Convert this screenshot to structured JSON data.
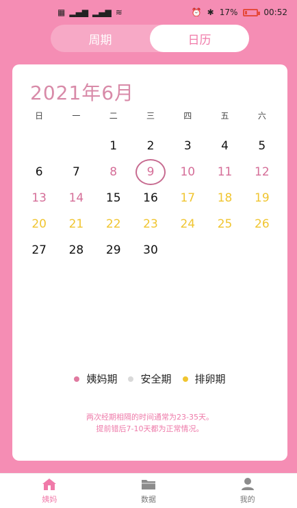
{
  "status_bar": {
    "left_icons": [
      "qr-icon",
      "signal-icon",
      "signal-icon",
      "wifi-icon"
    ],
    "right": {
      "battery": "17%",
      "time": "00:52"
    }
  },
  "segment": {
    "tabs": [
      {
        "label": "周期",
        "active": false
      },
      {
        "label": "日历",
        "active": true
      }
    ]
  },
  "calendar": {
    "title": "2021年6月",
    "weekdays": [
      "日",
      "一",
      "二",
      "三",
      "四",
      "五",
      "六"
    ],
    "days": [
      {
        "d": "",
        "type": "empty"
      },
      {
        "d": "",
        "type": "empty"
      },
      {
        "d": "1",
        "type": "normal"
      },
      {
        "d": "2",
        "type": "normal"
      },
      {
        "d": "3",
        "type": "normal"
      },
      {
        "d": "4",
        "type": "normal"
      },
      {
        "d": "5",
        "type": "normal"
      },
      {
        "d": "6",
        "type": "normal"
      },
      {
        "d": "7",
        "type": "normal"
      },
      {
        "d": "8",
        "type": "period"
      },
      {
        "d": "9",
        "type": "period",
        "today": true
      },
      {
        "d": "10",
        "type": "period"
      },
      {
        "d": "11",
        "type": "period"
      },
      {
        "d": "12",
        "type": "period"
      },
      {
        "d": "13",
        "type": "period"
      },
      {
        "d": "14",
        "type": "period"
      },
      {
        "d": "15",
        "type": "normal"
      },
      {
        "d": "16",
        "type": "normal"
      },
      {
        "d": "17",
        "type": "ovulation"
      },
      {
        "d": "18",
        "type": "ovulation"
      },
      {
        "d": "19",
        "type": "ovulation"
      },
      {
        "d": "20",
        "type": "ovulation"
      },
      {
        "d": "21",
        "type": "ovulation"
      },
      {
        "d": "22",
        "type": "ovulation"
      },
      {
        "d": "23",
        "type": "ovulation"
      },
      {
        "d": "24",
        "type": "ovulation"
      },
      {
        "d": "25",
        "type": "ovulation"
      },
      {
        "d": "26",
        "type": "ovulation"
      },
      {
        "d": "27",
        "type": "normal"
      },
      {
        "d": "28",
        "type": "normal"
      },
      {
        "d": "29",
        "type": "normal"
      },
      {
        "d": "30",
        "type": "normal"
      }
    ]
  },
  "legend": [
    {
      "label": "姨妈期",
      "color": "#e07aa0"
    },
    {
      "label": "安全期",
      "color": "#d9d9d9"
    },
    {
      "label": "排卵期",
      "color": "#f0c530"
    }
  ],
  "note": {
    "line1": "两次经期相隔的时间通常为23-35天。",
    "line2": "提前错后7-10天都为正常情况。"
  },
  "bottom_nav": [
    {
      "label": "姨妈",
      "icon": "home-icon",
      "active": true
    },
    {
      "label": "数据",
      "icon": "folder-icon",
      "active": false
    },
    {
      "label": "我的",
      "icon": "user-icon",
      "active": false
    }
  ],
  "colors": {
    "background": "#f58db4",
    "period": "#d56e98",
    "ovulation": "#f0c530",
    "accent": "#f07aa9"
  }
}
